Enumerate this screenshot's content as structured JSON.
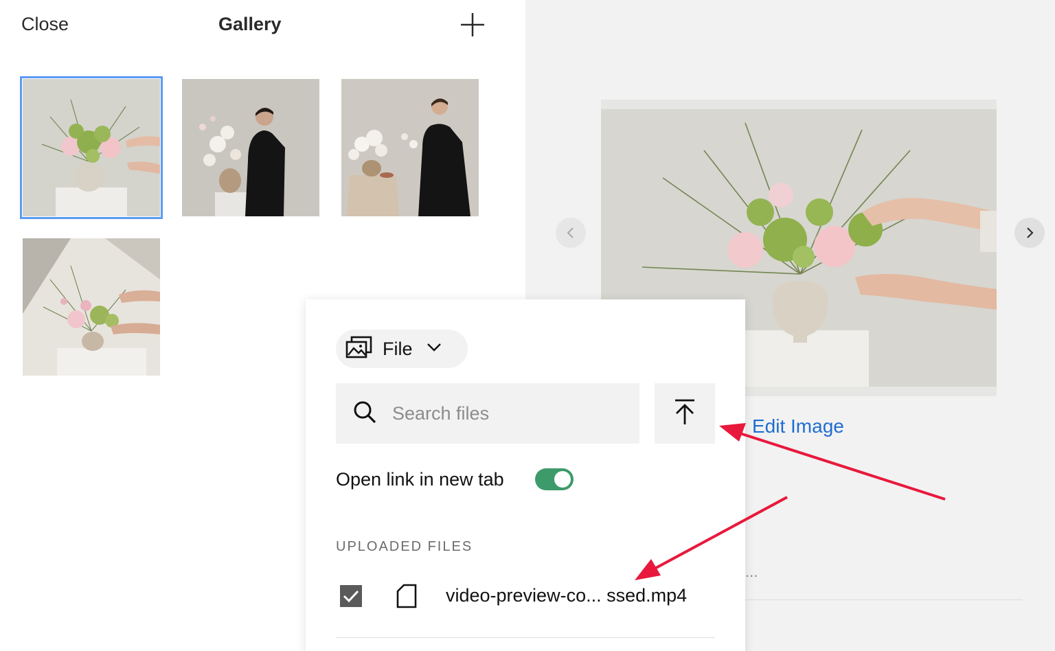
{
  "header": {
    "close_label": "Close",
    "title": "Gallery",
    "add_icon": "plus-icon"
  },
  "gallery": {
    "thumbnails": [
      {
        "name": "thumbnail-1",
        "selected": true
      },
      {
        "name": "thumbnail-2",
        "selected": false
      },
      {
        "name": "thumbnail-3",
        "selected": false
      },
      {
        "name": "thumbnail-4",
        "selected": false
      }
    ],
    "selection_color": "#5b9bf3"
  },
  "preview": {
    "prev_icon": "chevron-left-icon",
    "next_icon": "chevron-right-icon",
    "edit_label": "Edit Image",
    "truncated_text": "..."
  },
  "popover": {
    "type_dropdown": {
      "label": "File",
      "icon": "image-stack-icon",
      "chevron_icon": "chevron-down-icon"
    },
    "search": {
      "placeholder": "Search files",
      "value": "",
      "icon": "search-icon"
    },
    "upload_icon": "upload-icon",
    "open_new_tab": {
      "label": "Open link in new tab",
      "enabled": true,
      "color": "#3d9a6a"
    },
    "uploaded_heading": "UPLOADED FILES",
    "files": [
      {
        "name": "video-preview-co... ssed.mp4",
        "checked": true,
        "icon": "file-icon"
      }
    ]
  },
  "colors": {
    "link": "#1f6dd1",
    "annotation_arrow": "#e8193c"
  }
}
